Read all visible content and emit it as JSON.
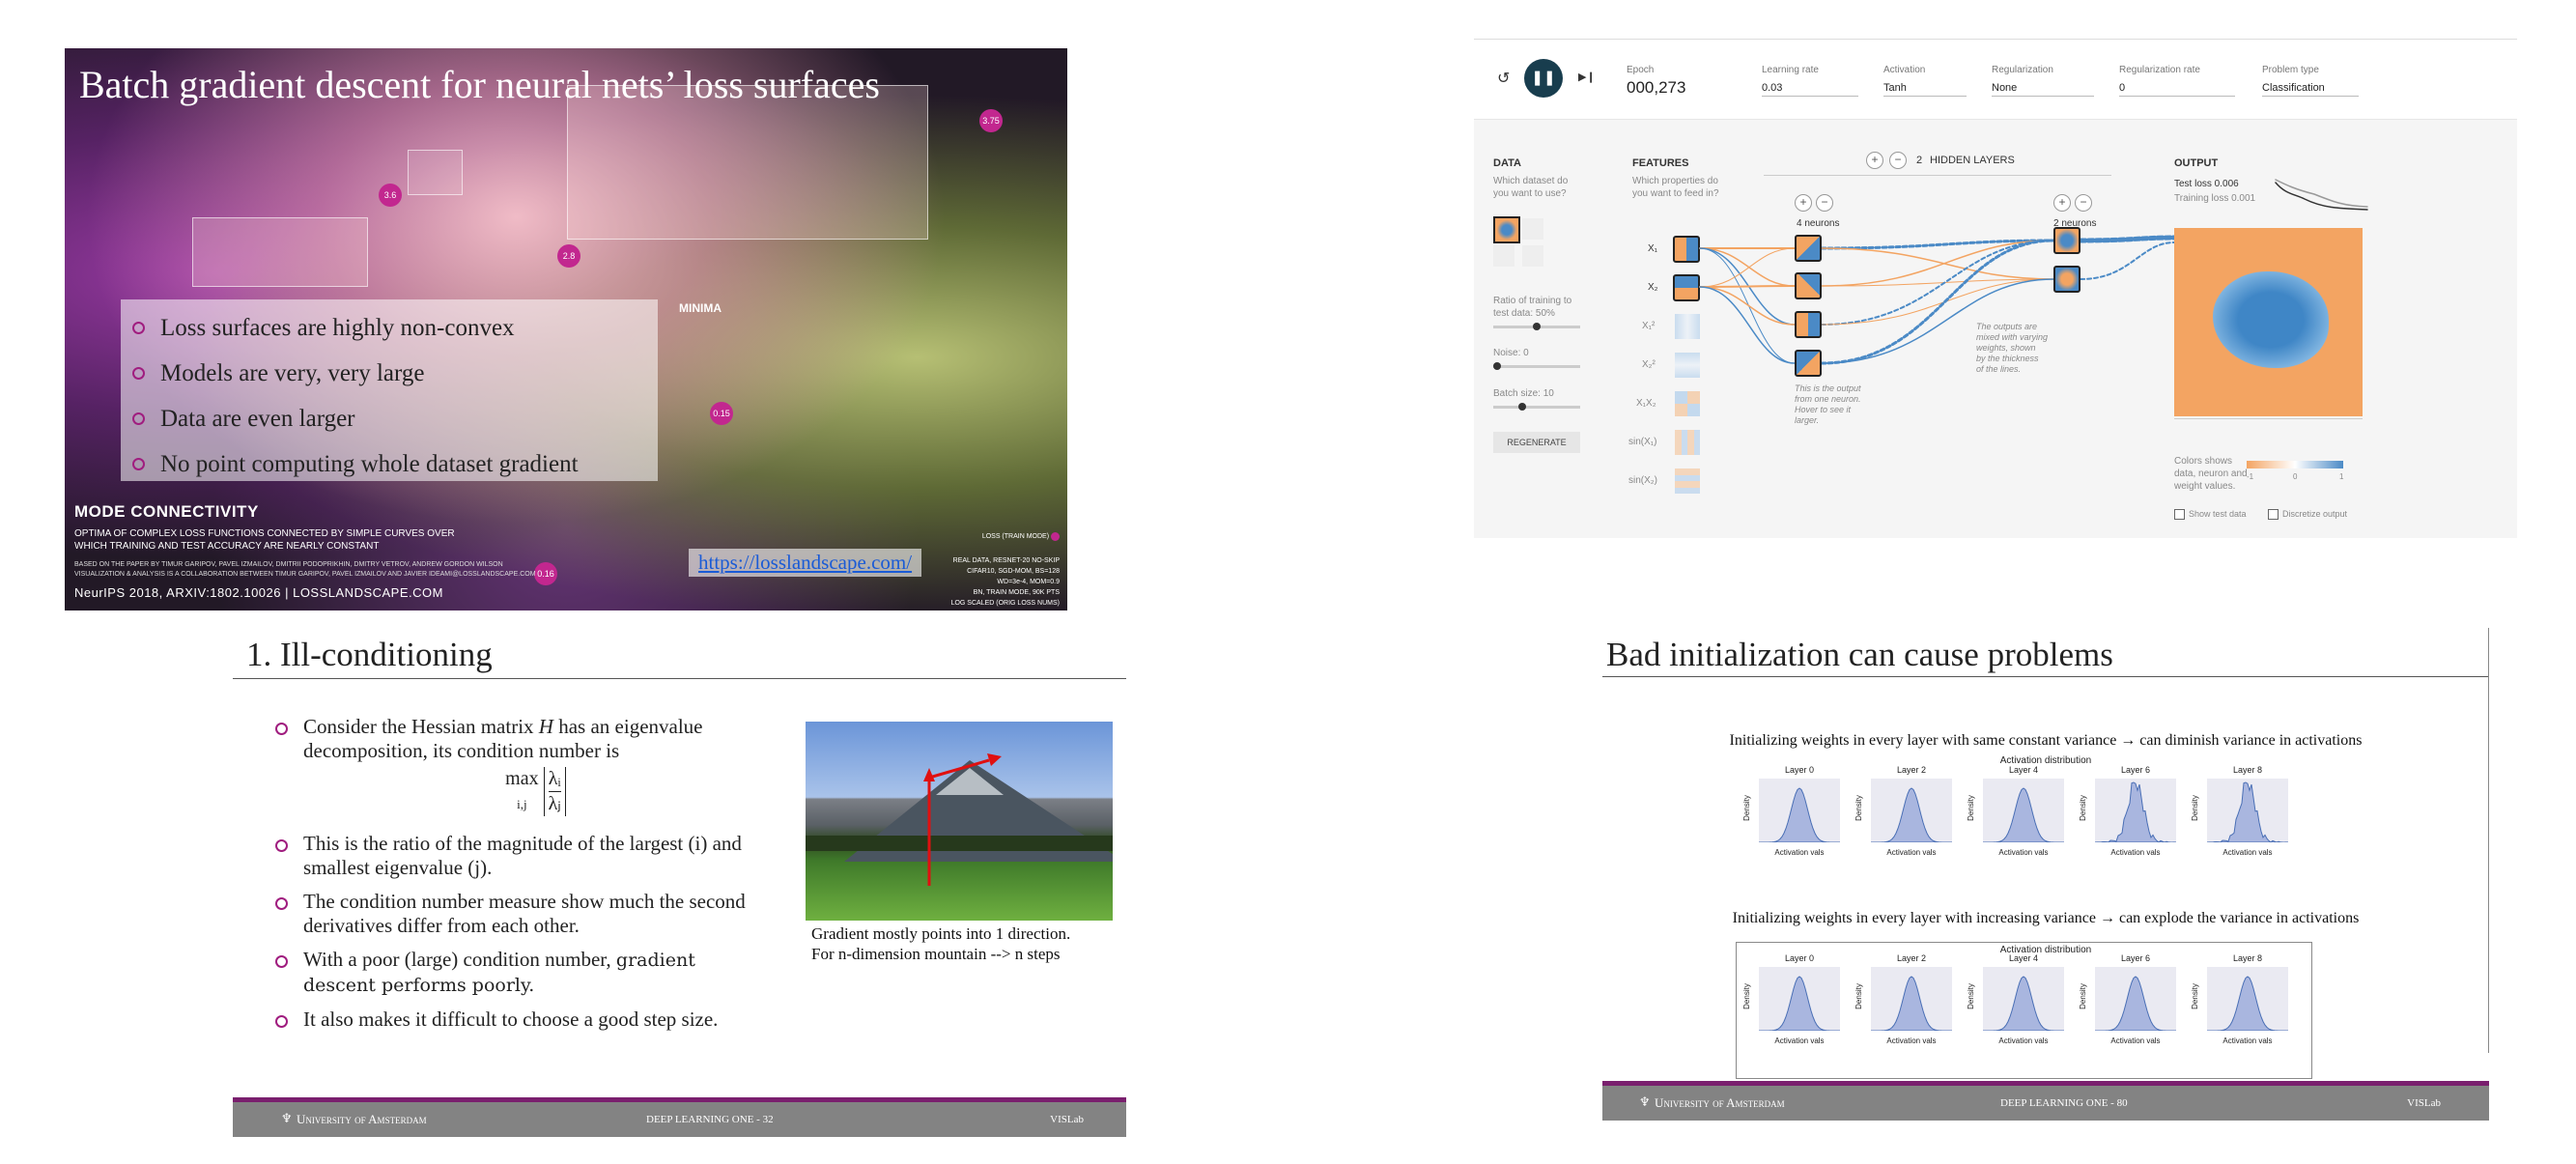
{
  "slide_nn": {
    "title": "Batch gradient descent for neural nets’ loss surfaces",
    "bullets": [
      "Loss surfaces are highly non-convex",
      "Models are very, very large",
      "Data are even larger",
      "No point computing whole dataset gradient"
    ],
    "markers": [
      "3.6",
      "2.8",
      "3.75",
      "0.15",
      "0.16"
    ],
    "minima_label": "MINIMA",
    "mode_heading": "MODE CONNECTIVITY",
    "mode_sub_1": "OPTIMA OF  COMPLEX LOSS FUNCTIONS CONNECTED BY SIMPLE CURVES OVER",
    "mode_sub_2": "WHICH TRAINING AND TEST ACCURACY ARE NEARLY CONSTANT",
    "credit_1": "BASED ON THE PAPER BY TIMUR GARIPOV, PAVEL IZMAILOV, DMITRII PODOPRIKHIN, DMITRY VETROV, ANDREW GORDON WILSON",
    "credit_2": "VISUALIZATION & ANALYSIS IS A COLLABORATION BETWEEN TIMUR GARIPOV, PAVEL IZMAILOV AND JAVIER IDEAMI@LOSSLANDSCAPE.COM",
    "footer_line": "NeurIPS 2018, ARXIV:1802.10026  |  LOSSLANDSCAPE.COM",
    "link": "https://losslandscape.com/",
    "loss_legend": "LOSS (TRAIN MODE)",
    "meta_lines": [
      "REAL DATA, RESNET-20 NO-SKIP",
      "CIFAR10, SGD-MOM, BS=128",
      "WD=3e-4, MOM=0.9",
      "BN, TRAIN MODE, 90K PTS",
      "LOG SCALED (ORIG LOSS NUMS)"
    ],
    "brand_color": "#c2278f"
  },
  "playground": {
    "epoch_label": "Epoch",
    "epoch_value": "000,273",
    "controls": [
      {
        "label": "Learning rate",
        "value": "0.03"
      },
      {
        "label": "Activation",
        "value": "Tanh"
      },
      {
        "label": "Regularization",
        "value": "None"
      },
      {
        "label": "Regularization rate",
        "value": "0"
      },
      {
        "label": "Problem type",
        "value": "Classification"
      }
    ],
    "data_title": "DATA",
    "data_sub_1": "Which dataset do",
    "data_sub_2": "you want to use?",
    "ratio_label_1": "Ratio of training to",
    "ratio_label_2": "test data:  50%",
    "noise_label": "Noise:  0",
    "batch_label": "Batch size:  10",
    "regenerate": "REGENERATE",
    "features_title": "FEATURES",
    "features_sub_1": "Which properties do",
    "features_sub_2": "you want to feed in?",
    "features": [
      "X₁",
      "X₂",
      "X₁²",
      "X₂²",
      "X₁X₂",
      "sin(X₁)",
      "sin(X₂)"
    ],
    "hidden_count": "2",
    "hidden_label": "HIDDEN LAYERS",
    "layer1_neurons": "4 neurons",
    "layer2_neurons": "2 neurons",
    "note_output_1": "This is the output",
    "note_output_2": "from one neuron.",
    "note_output_3": "Hover to see it",
    "note_output_4": "larger.",
    "note_weights_1": "The outputs are",
    "note_weights_2": "mixed with varying",
    "note_weights_3": "weights, shown",
    "note_weights_4": "by the thickness",
    "note_weights_5": "of the lines.",
    "output_title": "OUTPUT",
    "test_loss": "Test loss 0.006",
    "training_loss": "Training loss 0.001",
    "colors_note_1": "Colors shows",
    "colors_note_2": "data, neuron and",
    "colors_note_3": "weight values.",
    "scale_left": "-1",
    "scale_mid": "0",
    "scale_right": "1",
    "show_test": "Show test data",
    "discretize": "Discretize output",
    "orange": "#f3a462",
    "blue": "#4b8ac6"
  },
  "slide_ill": {
    "title": "1. Ill-conditioning",
    "bullet_1_a": "Consider the Hessian matrix",
    "bullet_1_var": "H",
    "bullet_1_b": "has an eigenvalue decomposition, its condition number is",
    "formula_max": "max",
    "formula_sub": "i,j",
    "formula_num": "λᵢ",
    "formula_den": "λⱼ",
    "bullet_2": "This is the ratio of the magnitude of the largest (i) and smallest eigenvalue (j).",
    "bullet_3": "The condition number measure show much the second derivatives differ from each other.",
    "bullet_4_a": "With a poor (large) condition number,",
    "bullet_4_b": "gradient descent performs poorly.",
    "bullet_5": "It also makes it difficult to choose a good step size.",
    "caption_1": "Gradient mostly points into 1 direction.",
    "caption_2": "For n-dimension mountain --> n steps",
    "footer_left": "University of Amsterdam",
    "footer_mid": "DEEP LEARNING ONE - 32",
    "footer_right": "VISLab"
  },
  "slide_init": {
    "title": "Bad initialization can cause problems",
    "caption_1": "Initializing weights in every layer with same constant variance → can diminish variance in activations",
    "caption_2": "Initializing weights in every layer with increasing variance → can explode the variance in activations",
    "fig_title": "Activation distribution",
    "layers": [
      "Layer 0",
      "Layer 2",
      "Layer 4",
      "Layer 6",
      "Layer 8"
    ],
    "xlabel": "Activation vals",
    "ylabel": "Density",
    "footer_left": "University of Amsterdam",
    "footer_mid": "DEEP LEARNING ONE - 80",
    "footer_right": "VISLab"
  }
}
